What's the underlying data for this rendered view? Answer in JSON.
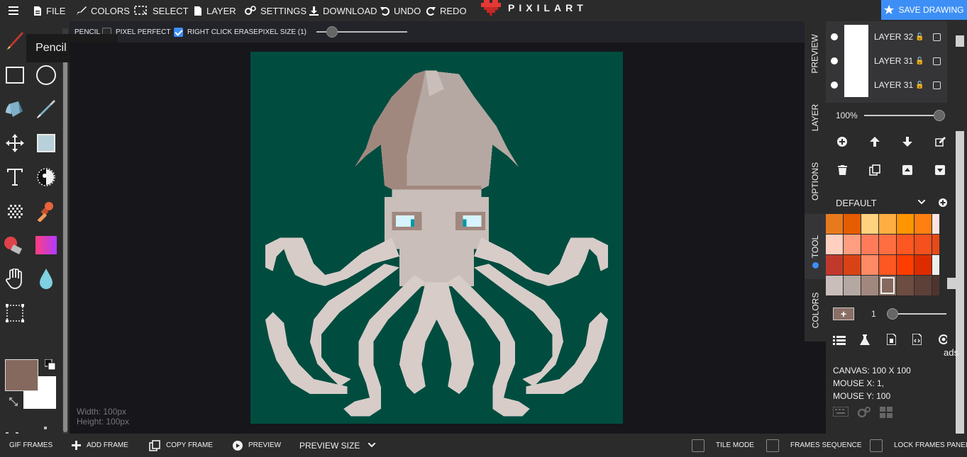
{
  "topbar": {
    "file": "FILE",
    "colors": "COLORS",
    "select": "SELECT",
    "layer": "LAYER",
    "settings": "SETTINGS",
    "download": "DOWNLOAD",
    "undo": "UNDO",
    "redo": "REDO",
    "logo": "PIXILART",
    "save": "SAVE DRAWING"
  },
  "options": {
    "tool_label": "PENCIL",
    "pixel_perfect": "PIXEL PERFECT",
    "pixel_perfect_checked": false,
    "right_click_erase": "RIGHT CLICK ERASE",
    "right_click_erase_checked": true,
    "pixel_size": "PIXEL SIZE (1)"
  },
  "tooltip": "Pencil Tool (P)",
  "tools": [
    "pencil-icon",
    "rectangle-icon",
    "circle-icon",
    "fill-bucket-icon",
    "eyedropper-icon",
    "move-icon",
    "fill-rect-icon",
    "text-icon",
    "lighten-icon",
    "dither-icon",
    "stamp-icon",
    "eraser-icon",
    "gradient-icon",
    "hand-icon",
    "blur-icon",
    "select-rect-icon"
  ],
  "colors": {
    "primary": "#85695f",
    "secondary": "#ffffff",
    "canvas_bg": "#004d40",
    "accent": "#3d8ff5"
  },
  "canvas_info": {
    "width": "Width: 100px",
    "height": "Height: 100px"
  },
  "side_tabs": [
    "PREVIEW",
    "LAYER",
    "OPTIONS",
    "TOOL",
    "COLORS"
  ],
  "layers": [
    {
      "name": "LAYER 32"
    },
    {
      "name": "LAYER 31"
    },
    {
      "name": "LAYER 31"
    }
  ],
  "layer_opacity": "100%",
  "palette": {
    "name": "DEFAULT",
    "swatches": [
      "#e87a1e",
      "#e65c00",
      "#ffd27f",
      "#ffae42",
      "#ff9500",
      "#ff7f11",
      "#fde4e1",
      "#ffd0bf",
      "#ff9e80",
      "#ff7b5a",
      "#ff6e40",
      "#ff5722",
      "#f4511e",
      "#e64a19",
      "#c0392b",
      "#d84315",
      "#ff8a65",
      "#ff5722",
      "#ff3d00",
      "#dd2c00",
      "#eeeeec",
      "#c9beb9",
      "#b5a8a2",
      "#a1887f",
      "#85695f",
      "#6d4c41",
      "#5d4037",
      "#4e342e"
    ],
    "selected_index": 24
  },
  "brush_size": "1",
  "status": {
    "canvas": "CANVAS: 100 X 100",
    "mouse_x": "MOUSE X: 1,",
    "mouse_y": "MOUSE Y: 100"
  },
  "ads_label": "ads",
  "bottom": {
    "gif_frames": "GIF FRAMES",
    "add_frame": "ADD FRAME",
    "copy_frame": "COPY FRAME",
    "preview": "PREVIEW",
    "preview_size": "PREVIEW SIZE",
    "tile_mode": "TILE MODE",
    "frames_sequence": "FRAMES SEQUENCE",
    "lock_frames": "LOCK FRAMES PANEL"
  }
}
